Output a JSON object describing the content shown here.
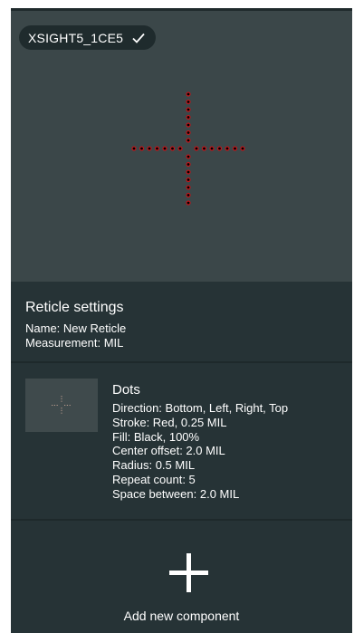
{
  "device": {
    "name": "XSIGHT5_1CE5",
    "connected_icon": "check-icon"
  },
  "reticle_settings": {
    "title": "Reticle settings",
    "name_line": "Name: New Reticle",
    "measurement_line": "Measurement: MIL"
  },
  "component": {
    "title": "Dots",
    "properties": [
      "Direction: Bottom, Left, Right, Top",
      "Stroke: Red, 0.25 MIL",
      "Fill: Black, 100%",
      "Center offset: 2.0 MIL",
      "Radius: 0.5 MIL",
      "Repeat count: 5",
      "Space between: 2.0 MIL"
    ],
    "thumbnail_icon": "crosshair-icon"
  },
  "add_component": {
    "label": "Add new component",
    "icon": "plus-icon"
  },
  "colors": {
    "screen_bg": "#263336",
    "preview_bg": "#3b4749",
    "dot_stroke": "#c0161b",
    "dot_fill": "#000000"
  }
}
